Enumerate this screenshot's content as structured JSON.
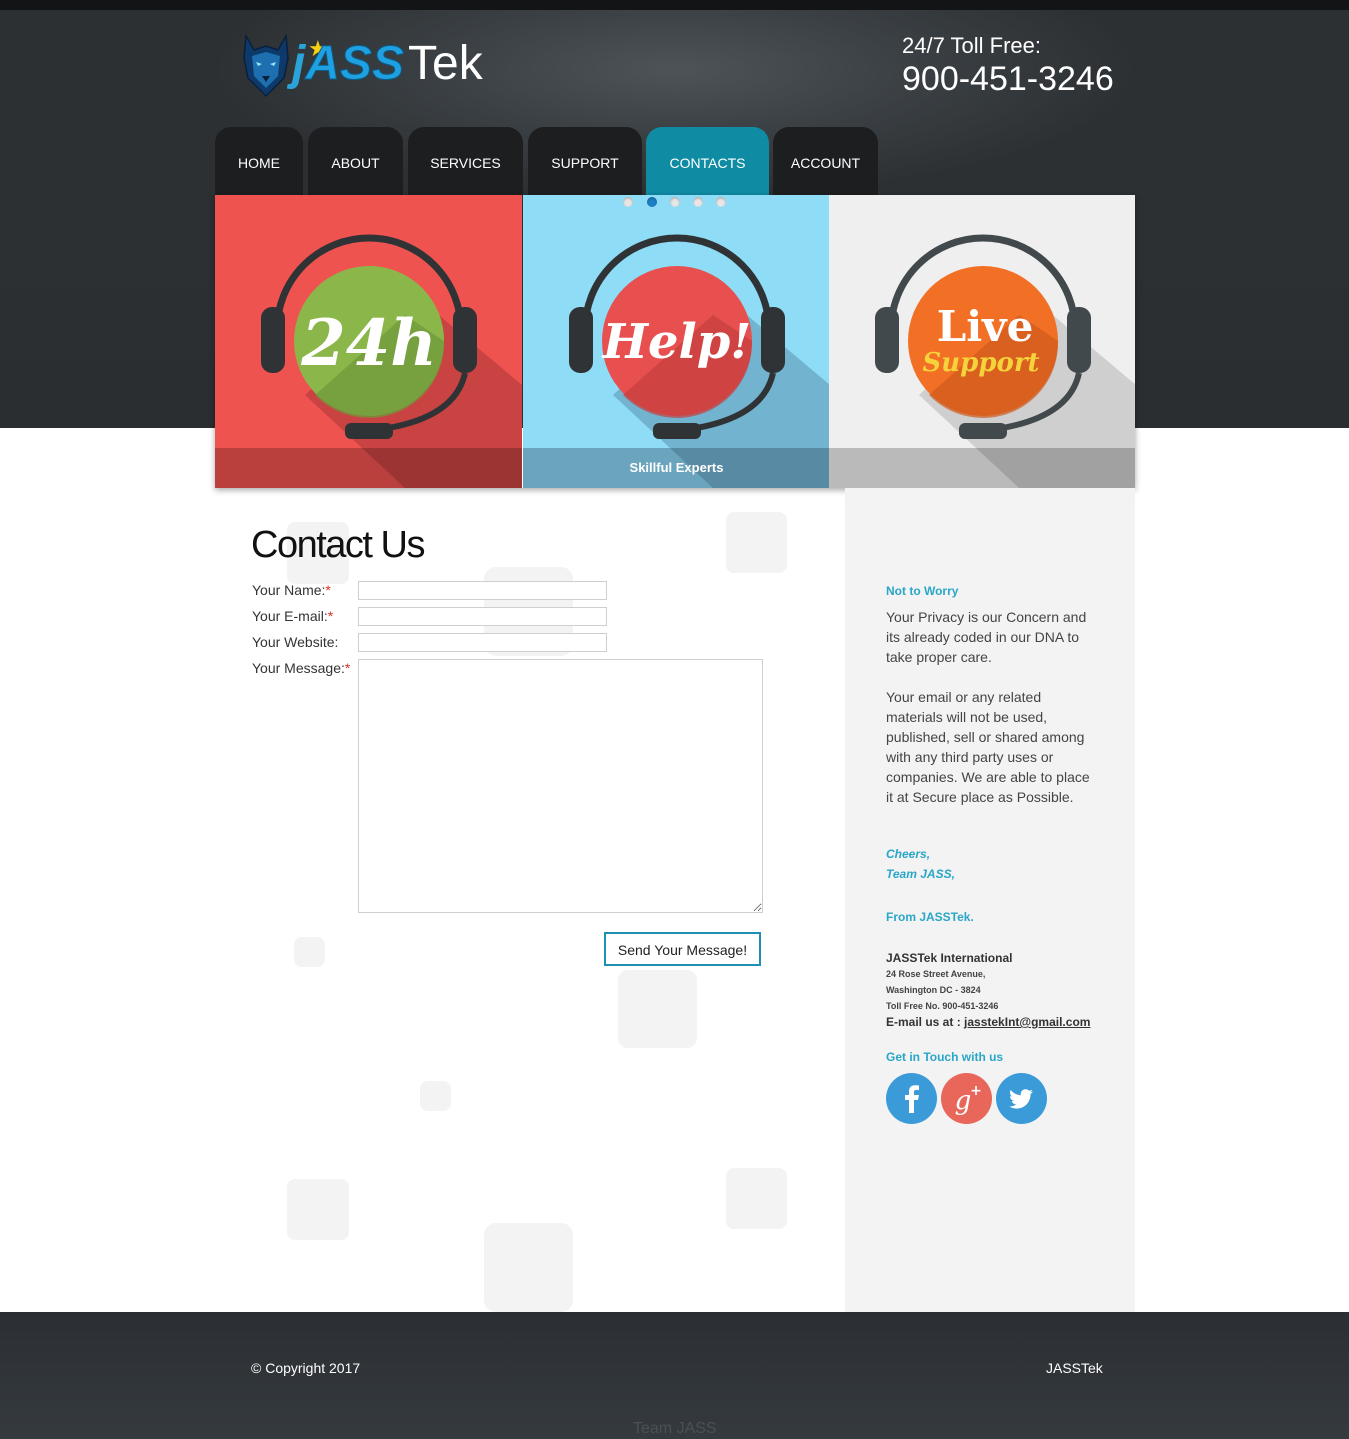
{
  "brand": {
    "logo_j": "j",
    "logo_ass": "ASS",
    "logo_tek": "Tek"
  },
  "header": {
    "toll_label": "24/7 Toll Free:",
    "toll_number": "900-451-3246"
  },
  "nav": {
    "items": [
      {
        "label": "HOME"
      },
      {
        "label": "ABOUT"
      },
      {
        "label": "SERVICES"
      },
      {
        "label": "SUPPORT"
      },
      {
        "label": "CONTACTS",
        "active": true
      },
      {
        "label": "ACCOUNT"
      }
    ]
  },
  "slider": {
    "panels": [
      {
        "badge_text": "24h",
        "bg": "#ef5350",
        "badge_color": "#8bb74a"
      },
      {
        "badge_text": "Help!",
        "caption": "Skillful Experts",
        "bg": "#8fdcf7",
        "badge_color": "#e84f4f"
      },
      {
        "badge_text_1": "Live",
        "badge_text_2": "Support",
        "bg": "#efefef",
        "badge_color": "#f27025"
      }
    ],
    "dots_total": 5,
    "active_dot": 2
  },
  "contact": {
    "title": "Contact Us",
    "name_label": "Your Name:",
    "email_label": "Your E-mail:",
    "website_label": "Your Website:",
    "message_label": "Your Message:",
    "required_mark": "*",
    "name_value": "",
    "email_value": "",
    "website_value": "",
    "message_value": "",
    "send_label": "Send Your Message!"
  },
  "sidebar": {
    "heading": "Not to Worry",
    "para1": "Your Privacy is our Concern and its already coded in our DNA to take proper care.",
    "para2": "Your email or any related materials will not be used, published, sell or shared among with any third party uses or companies. We are able to place it at Secure place as Possible.",
    "cheers": "Cheers,",
    "team": "Team JASS,",
    "from": "From JASSTek.",
    "company": "JASSTek International",
    "address1": "24 Rose Street Avenue,",
    "address2": "Washington DC - 3824",
    "tollfree": "Toll Free No. 900-451-3246",
    "email_label": "E-mail us at :",
    "email": "jasstekInt@gmail.com",
    "social_heading": "Get in Touch with us",
    "social": [
      {
        "icon": "facebook-icon",
        "color": "#3b9bd9"
      },
      {
        "icon": "google-plus-icon",
        "color": "#e9665a"
      },
      {
        "icon": "twitter-icon",
        "color": "#3b9bd9"
      }
    ]
  },
  "footer": {
    "copyright": "© Copyright 2017",
    "brand": "JASSTek",
    "team": "Team JASS"
  }
}
